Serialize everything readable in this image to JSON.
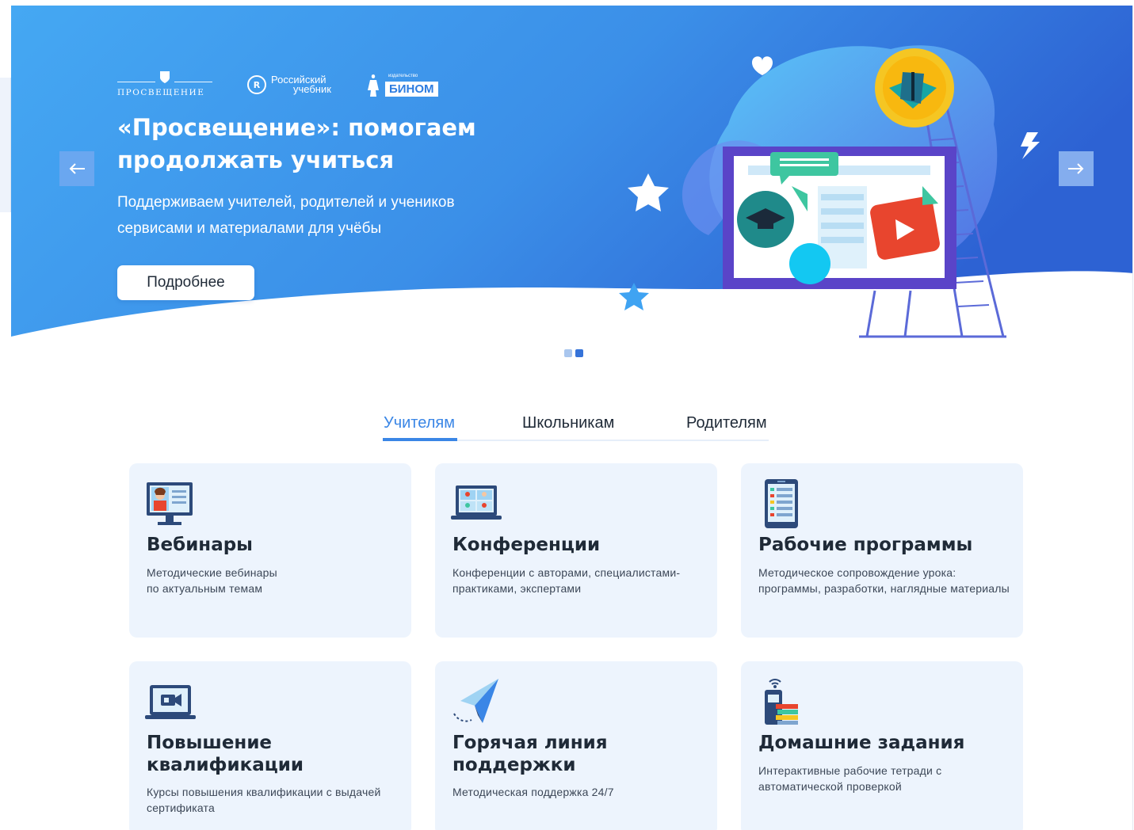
{
  "hero": {
    "logos": {
      "prosveshchenie": "ПРОСВЕЩЕНИЕ",
      "rossiyskiy_line1": "Российский",
      "rossiyskiy_line2": "учебник",
      "binom_small": "издательство",
      "binom": "БИНОМ"
    },
    "title": "«Просвещение»: помогаем продолжать учиться",
    "subtitle": "Поддерживаем учителей, родителей и учеников сервисами и материалами для учёбы",
    "button_label": "Подробнее",
    "prev_icon": "arrow-left-icon",
    "next_icon": "arrow-right-icon",
    "slides_count": 2,
    "active_slide": 2
  },
  "tabs": [
    {
      "label": "Учителям",
      "active": true
    },
    {
      "label": "Школьникам",
      "active": false
    },
    {
      "label": "Родителям",
      "active": false
    }
  ],
  "cards": [
    {
      "icon": "webinar-monitor-icon",
      "title": "Вебинары",
      "description": "Методические вебинары\nпо актуальным темам"
    },
    {
      "icon": "conference-laptop-icon",
      "title": "Конференции",
      "description": "Конференции с авторами, специалистами-практиками, экспертами"
    },
    {
      "icon": "program-tablet-icon",
      "title": "Рабочие программы",
      "description": "Методическое сопровождение урока: программы, разработки, наглядные материалы"
    },
    {
      "icon": "video-course-laptop-icon",
      "title": "Повышение квалификации",
      "description": "Курсы повышения квалификации с выдачей сертификата"
    },
    {
      "icon": "paper-plane-icon",
      "title": "Горячая линия поддержки",
      "description": "Методическая поддержка 24/7"
    },
    {
      "icon": "homework-books-icon",
      "title": "Домашние задания",
      "description": "Интерактивные рабочие тетради с автоматической проверкой"
    }
  ],
  "colors": {
    "hero_start": "#3fa3f2",
    "hero_end": "#2f6ad6",
    "accent": "#3a86e6",
    "card_bg": "#edf4fd"
  }
}
